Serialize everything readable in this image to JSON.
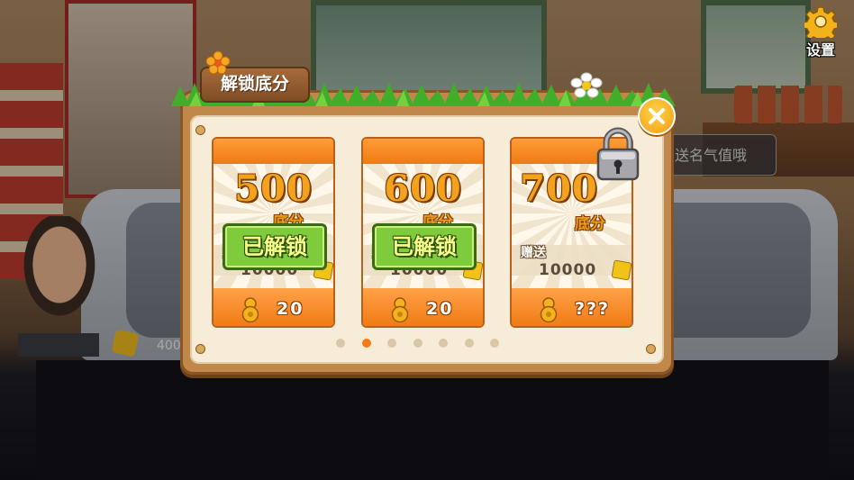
{
  "background": {
    "notice_text": "送名气值哦",
    "coin_value": "400",
    "settings_label": "设置"
  },
  "dialog": {
    "title": "解锁底分",
    "close_icon": "close-icon",
    "cards": [
      {
        "score": "500",
        "unit": "底分",
        "bonus_label": "赠送",
        "bonus_value": "10000",
        "status": "已解锁",
        "price": "20",
        "locked": false
      },
      {
        "score": "600",
        "unit": "底分",
        "bonus_label": "赠送",
        "bonus_value": "10000",
        "status": "已解锁",
        "price": "20",
        "locked": false
      },
      {
        "score": "700",
        "unit": "底分",
        "bonus_label": "赠送",
        "bonus_value": "10000",
        "status": "",
        "price": "???",
        "locked": true
      }
    ],
    "pagination": {
      "total": 7,
      "current": 2
    }
  },
  "colors": {
    "accent_orange": "#f07a12",
    "unlocked_green": "#7ecb3b",
    "panel_brown": "#c2884a"
  }
}
